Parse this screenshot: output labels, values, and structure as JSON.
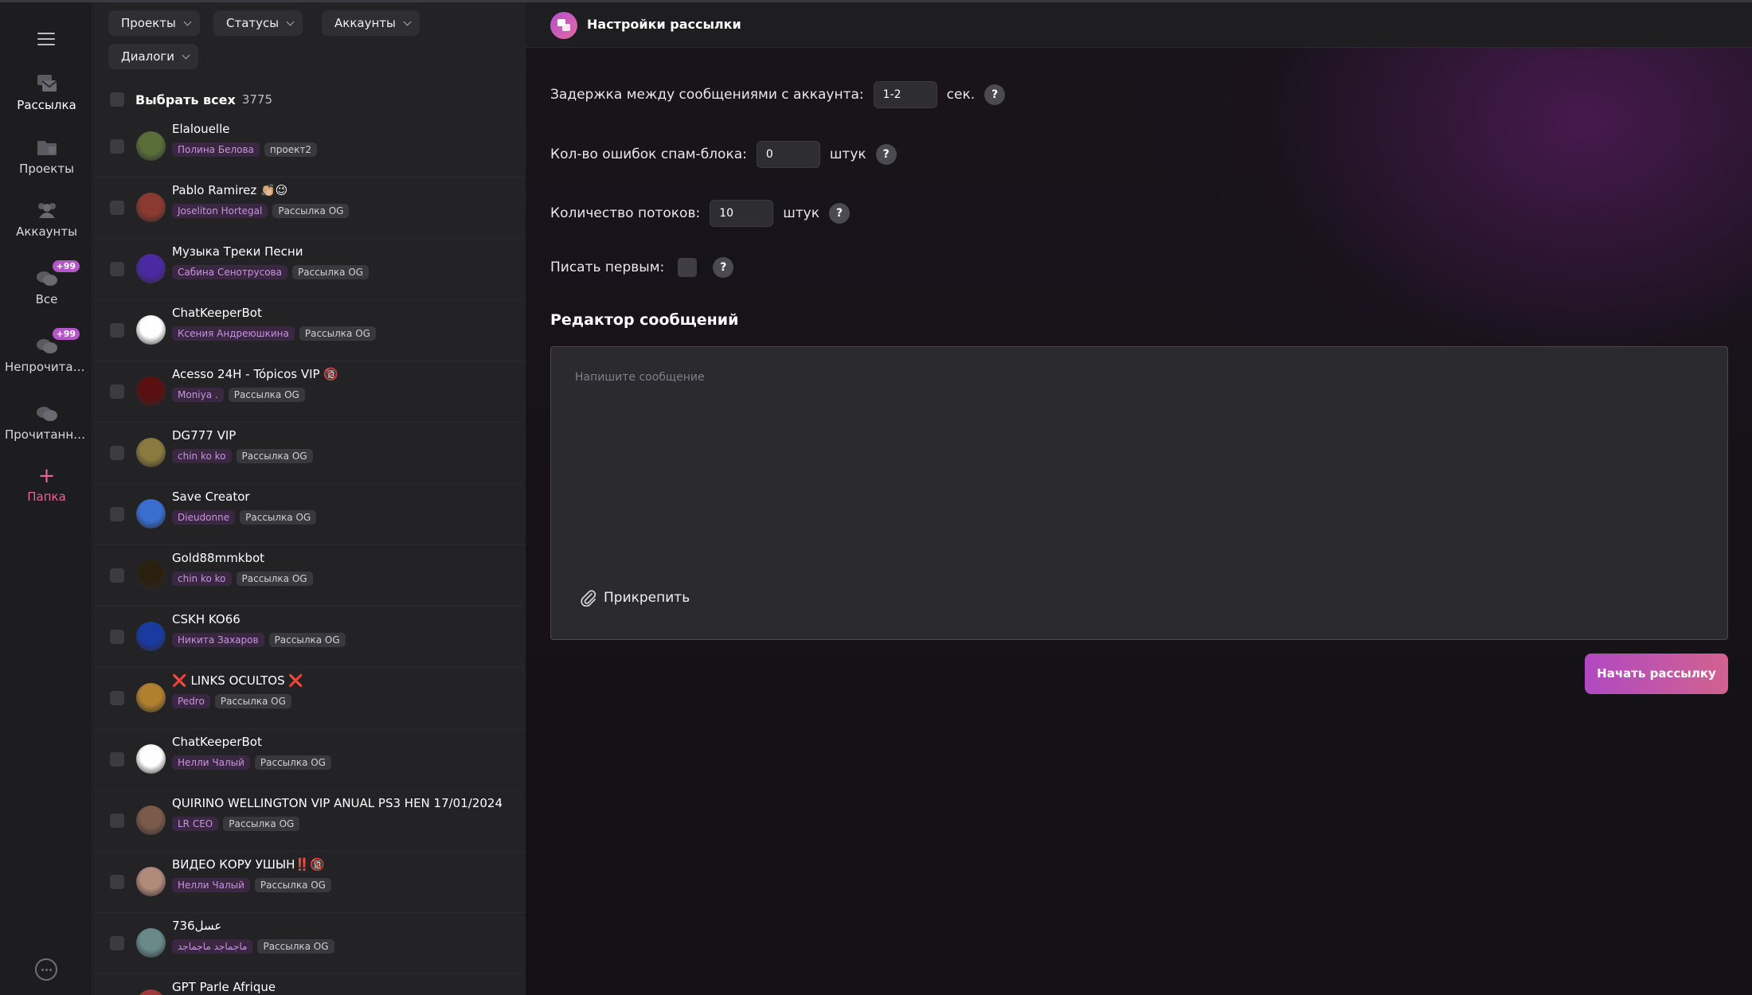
{
  "nav": {
    "items": [
      {
        "label": "Рассылка",
        "icon": "mailing-icon"
      },
      {
        "label": "Проекты",
        "icon": "folder-icon"
      },
      {
        "label": "Аккаунты",
        "icon": "users-icon"
      },
      {
        "label": "Все",
        "icon": "chats-icon",
        "badge": "+99"
      },
      {
        "label": "Непрочитанные",
        "icon": "chats-icon",
        "badge": "+99"
      },
      {
        "label": "Прочитанные",
        "icon": "chats-icon"
      },
      {
        "label": "Папка",
        "icon": "plus-icon"
      }
    ]
  },
  "filters": [
    "Проекты",
    "Статусы",
    "Аккаунты",
    "Диалоги"
  ],
  "select_all": {
    "label": "Выбрать всех",
    "count": "3775"
  },
  "dialogs": [
    {
      "name": "Elalouelle",
      "user": "Полина Белова",
      "project": "проект2",
      "color": "#5a6e3a"
    },
    {
      "name": "Pablo Ramirez 👏🏼😉",
      "user": "Joseliton Hortegal",
      "project": "Рассылка OG",
      "color": "#8a3a30"
    },
    {
      "name": "Музыка Треки Песни",
      "user": "Сабина Сенотрусова",
      "project": "Рассылка OG",
      "color": "#4a2aa0"
    },
    {
      "name": "ChatKeeperBot",
      "user": "Ксения Андреюшкина",
      "project": "Рассылка OG",
      "color": "#ffffff"
    },
    {
      "name": "Acesso 24H - Tópicos VIP 🔞",
      "user": "Moniya .",
      "project": "Рассылка OG",
      "color": "#5a1010"
    },
    {
      "name": "DG777 VIP",
      "user": "chin ko ko",
      "project": "Рассылка OG",
      "color": "#8a7a40"
    },
    {
      "name": "Save Creator",
      "user": "Dieudonne",
      "project": "Рассылка OG",
      "color": "#3a6fd0"
    },
    {
      "name": "Gold88mmkbot",
      "user": "chin ko ko",
      "project": "Рассылка OG",
      "color": "#2a2010"
    },
    {
      "name": "CSKH KO66",
      "user": "Никита Захаров",
      "project": "Рассылка OG",
      "color": "#1a3aa0"
    },
    {
      "name": "❌ LINKS OCULTOS ❌",
      "user": "Pedro",
      "project": "Рассылка OG",
      "color": "#b08030"
    },
    {
      "name": "ChatKeeperBot",
      "user": "Нелли Чалый",
      "project": "Рассылка OG",
      "color": "#ffffff"
    },
    {
      "name": "QUIRINO WELLINGTON VIP ANUAL PS3 HEN 17/01/2024",
      "user": "LR CEO",
      "project": "Рассылка OG",
      "color": "#7a5a4a"
    },
    {
      "name": "ВИДЕО КОРУ УШЫН‼️🔞",
      "user": "Нелли Чалый",
      "project": "Рассылка OG",
      "color": "#b08a7a"
    },
    {
      "name": "736عسل",
      "user": "ماجماجد ماجماجد",
      "project": "Рассылка OG",
      "color": "#6a8a8a"
    },
    {
      "name": "GPT Parle Afrique",
      "user": "",
      "project": "",
      "color": "#a03a3a"
    }
  ],
  "header": {
    "title": "Настройки рассылки"
  },
  "settings": {
    "delay": {
      "label": "Задержка между сообщениями с аккаунта:",
      "value": "1-2",
      "unit": "сек."
    },
    "spam_errors": {
      "label": "Кол-во ошибок спам-блока:",
      "value": "0",
      "unit": "штук"
    },
    "threads": {
      "label": "Количество потоков:",
      "value": "10",
      "unit": "штук"
    },
    "write_first": {
      "label": "Писать первым:"
    },
    "help": "?"
  },
  "editor": {
    "title": "Редактор сообщений",
    "placeholder": "Напишите сообщение",
    "attach_label": "Прикрепить"
  },
  "start_button": "Начать рассылку",
  "colors": {
    "accent": "#b455c8",
    "pink": "#e2669a"
  }
}
